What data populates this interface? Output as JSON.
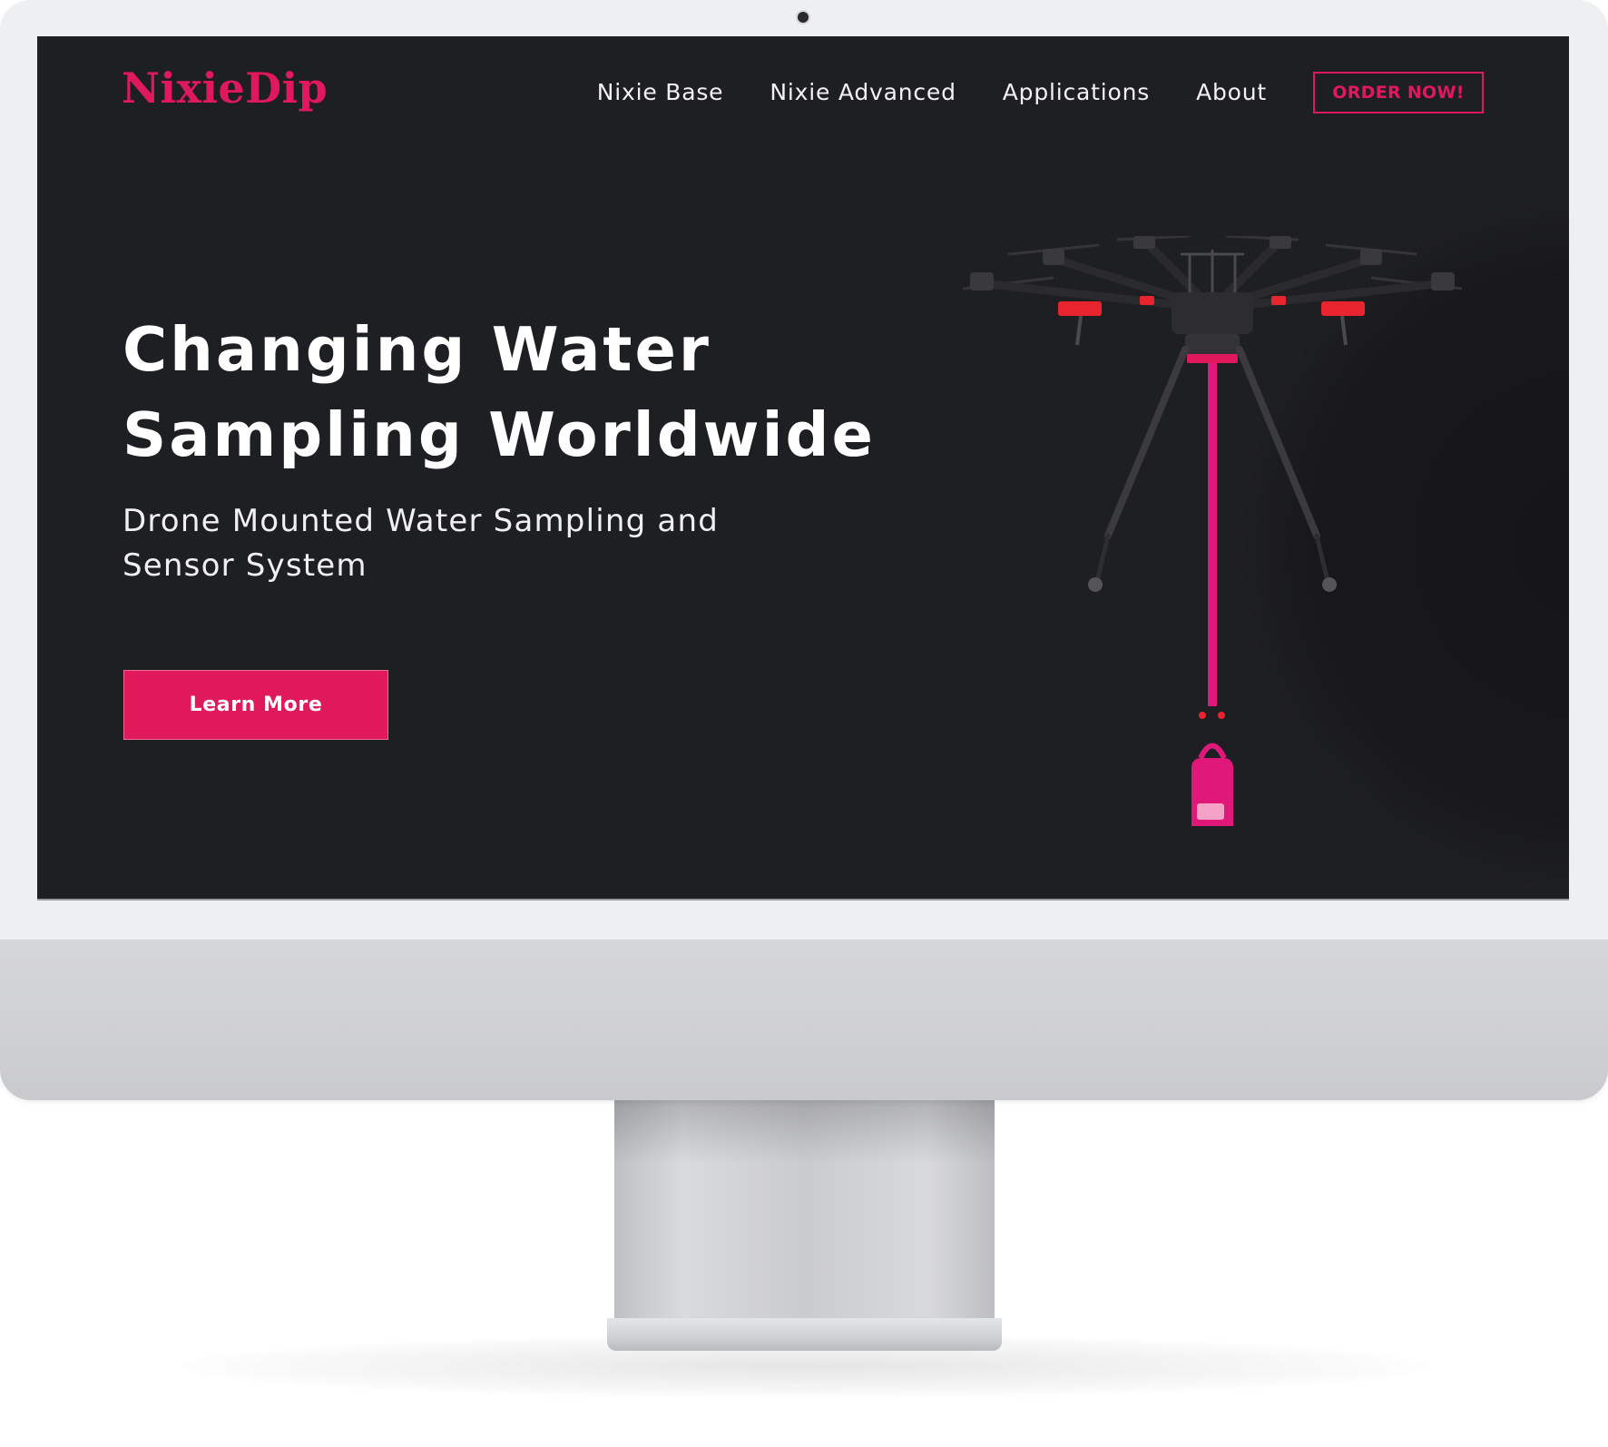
{
  "site": {
    "logo": "NixieDip",
    "nav": {
      "items": [
        {
          "label": "Nixie Base"
        },
        {
          "label": "Nixie Advanced"
        },
        {
          "label": "Applications"
        },
        {
          "label": "About"
        }
      ],
      "cta_label": "ORDER NOW!"
    },
    "hero": {
      "title_line1": "Changing Water",
      "title_line2": "Sampling Worldwide",
      "subtitle_line1": "Drone Mounted Water Sampling and",
      "subtitle_line2": "Sensor System",
      "button_label": "Learn More"
    },
    "colors": {
      "accent": "#e0185c",
      "background": "#1e1f22",
      "text": "#ffffff"
    },
    "image": "drone-with-water-sampler-icon"
  }
}
